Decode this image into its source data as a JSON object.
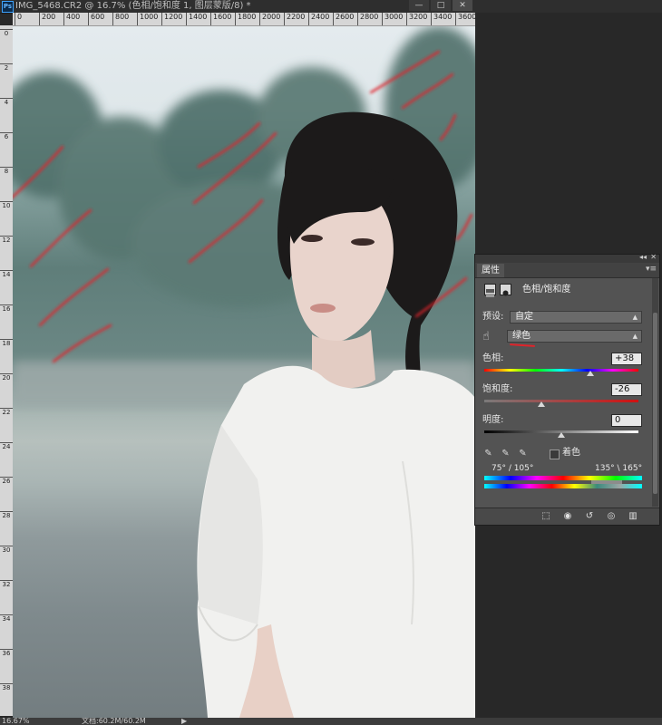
{
  "window": {
    "title": "IMG_5468.CR2 @ 16.7% (色相/饱和度 1, 图层蒙版/8) *",
    "app_icon": "Ps",
    "min_label": "—",
    "restore_label": "□",
    "close_label": "✕"
  },
  "ruler": {
    "top_ticks": [
      "0",
      "200",
      "400",
      "600",
      "800",
      "1000",
      "1200",
      "1400",
      "1600",
      "1800",
      "2000",
      "2200",
      "2400",
      "2600",
      "2800",
      "3000",
      "3200",
      "3400",
      "3600"
    ],
    "left_ticks": [
      "0",
      "2",
      "4",
      "6",
      "8",
      "10",
      "12",
      "14",
      "16",
      "18",
      "20",
      "22",
      "24",
      "26",
      "28",
      "30",
      "32",
      "34",
      "36",
      "38"
    ]
  },
  "status": {
    "zoom": "16.67%",
    "file_info": "文档:60.2M/60.2M",
    "arrow": "▶"
  },
  "panel": {
    "tab_label": "属性",
    "collapse_label": "◂◂",
    "close_label": "✕",
    "menu_label": "▾≡",
    "adjustment_title": "色相/饱和度",
    "preset_label": "预设:",
    "preset_value": "自定",
    "channel_value": "绿色",
    "hue_label": "色相:",
    "hue_value": "+38",
    "saturation_label": "饱和度:",
    "saturation_value": "-26",
    "lightness_label": "明度:",
    "lightness_value": "0",
    "colorize_label": "着色",
    "colorize_checked": false,
    "range_left": "75° / 105°",
    "range_right": "135° \\ 165°",
    "hue_slider": 0.69,
    "saturation_slider": 0.37,
    "lightness_slider": 0.5,
    "icons": {
      "adjustment": "hue-saturation-icon",
      "mask": "mask-icon",
      "hand": "hand-target-icon",
      "eyedropper": "eyedropper-icon",
      "eyedropper_add": "eyedropper-plus-icon",
      "eyedropper_sub": "eyedropper-minus-icon"
    },
    "footer_icons": [
      "clip-to-layer-icon",
      "view-previous-icon",
      "reset-icon",
      "visibility-eye-icon",
      "trash-icon"
    ]
  },
  "colors": {
    "annotation_red": "#e0232a",
    "panel_bg": "#535353",
    "workspace_bg": "#282828"
  }
}
